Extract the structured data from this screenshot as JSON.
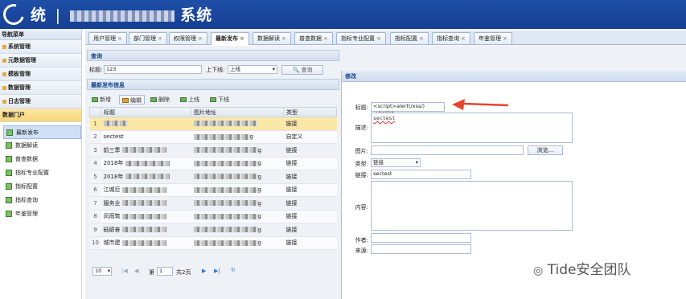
{
  "app": {
    "title_prefix": "统",
    "title_suffix": "系统",
    "title_glyph": "|"
  },
  "sidebar": {
    "header": "导航菜单",
    "groups": [
      {
        "label": "系统管理"
      },
      {
        "label": "元数据管理"
      },
      {
        "label": "模板管理"
      },
      {
        "label": "数据管理"
      },
      {
        "label": "日志管理"
      },
      {
        "label": "数据门户"
      }
    ],
    "subitems": [
      {
        "label": "最新发布"
      },
      {
        "label": "数据解读"
      },
      {
        "label": "普查数据"
      },
      {
        "label": "指标专业配置"
      },
      {
        "label": "指标配置"
      },
      {
        "label": "指标查询"
      },
      {
        "label": "年鉴管理"
      }
    ]
  },
  "tabs": [
    {
      "label": "用户管理"
    },
    {
      "label": "部门管理"
    },
    {
      "label": "权限管理"
    },
    {
      "label": "最新发布"
    },
    {
      "label": "数据解读"
    },
    {
      "label": "普查数据"
    },
    {
      "label": "指标专业配置"
    },
    {
      "label": "指标配置"
    },
    {
      "label": "指标查询"
    },
    {
      "label": "年鉴管理"
    }
  ],
  "tab_close": "×",
  "query": {
    "panel_title": "查询",
    "title_label": "标题:",
    "title_value": "123",
    "status_label": "上下线:",
    "status_value": "上线",
    "search_button": "查询"
  },
  "list": {
    "panel_title": "最新发布信息",
    "toolbar": {
      "add": "新增",
      "edit": "编辑",
      "delete": "删除",
      "online": "上线",
      "offline": "下线"
    },
    "columns": [
      "",
      "标题",
      "图片地址",
      "类型"
    ],
    "rows": [
      {
        "num": "1",
        "title": "",
        "img_tail": "",
        "type": "链接"
      },
      {
        "num": "2",
        "title": "sectest",
        "img_tail": "g",
        "type": "自定义"
      },
      {
        "num": "3",
        "title": "前三季",
        "img_tail": "g",
        "type": "链接"
      },
      {
        "num": "4",
        "title": "2018年",
        "img_tail": "g",
        "type": "链接"
      },
      {
        "num": "5",
        "title": "2018年",
        "img_tail": "g",
        "type": "链接"
      },
      {
        "num": "6",
        "title": "江城巨",
        "img_tail": "g",
        "type": "链接"
      },
      {
        "num": "7",
        "title": "服务业",
        "img_tail": "g",
        "type": "链接"
      },
      {
        "num": "8",
        "title": "凤雨筑",
        "img_tail": "g",
        "type": "链接"
      },
      {
        "num": "9",
        "title": "砥砺奋",
        "img_tail": "g",
        "type": "链接"
      },
      {
        "num": "10",
        "title": "城市建",
        "img_tail": "g",
        "type": "链接"
      }
    ]
  },
  "pager": {
    "page_size": "10",
    "page_prefix": "第",
    "page_value": "1",
    "page_total": "共2页"
  },
  "modal": {
    "title": "修改",
    "title_label": "标题:",
    "title_value": "<script>alert(/xss/)</script",
    "desc_label": "描述:",
    "desc_value": "sectest",
    "image_label": "图片:",
    "browse_button": "浏览...",
    "type_label": "类型:",
    "type_value": "链接",
    "link_label": "链接:",
    "link_value": "sectest",
    "content_label": "内容:",
    "author_label": "作者:",
    "source_label": "来源:"
  },
  "watermark": "Tide安全团队",
  "colors": {
    "header": "#1f4fa7",
    "accent_arrow": "#e8432e",
    "row_selected": "#fbe7a6"
  }
}
